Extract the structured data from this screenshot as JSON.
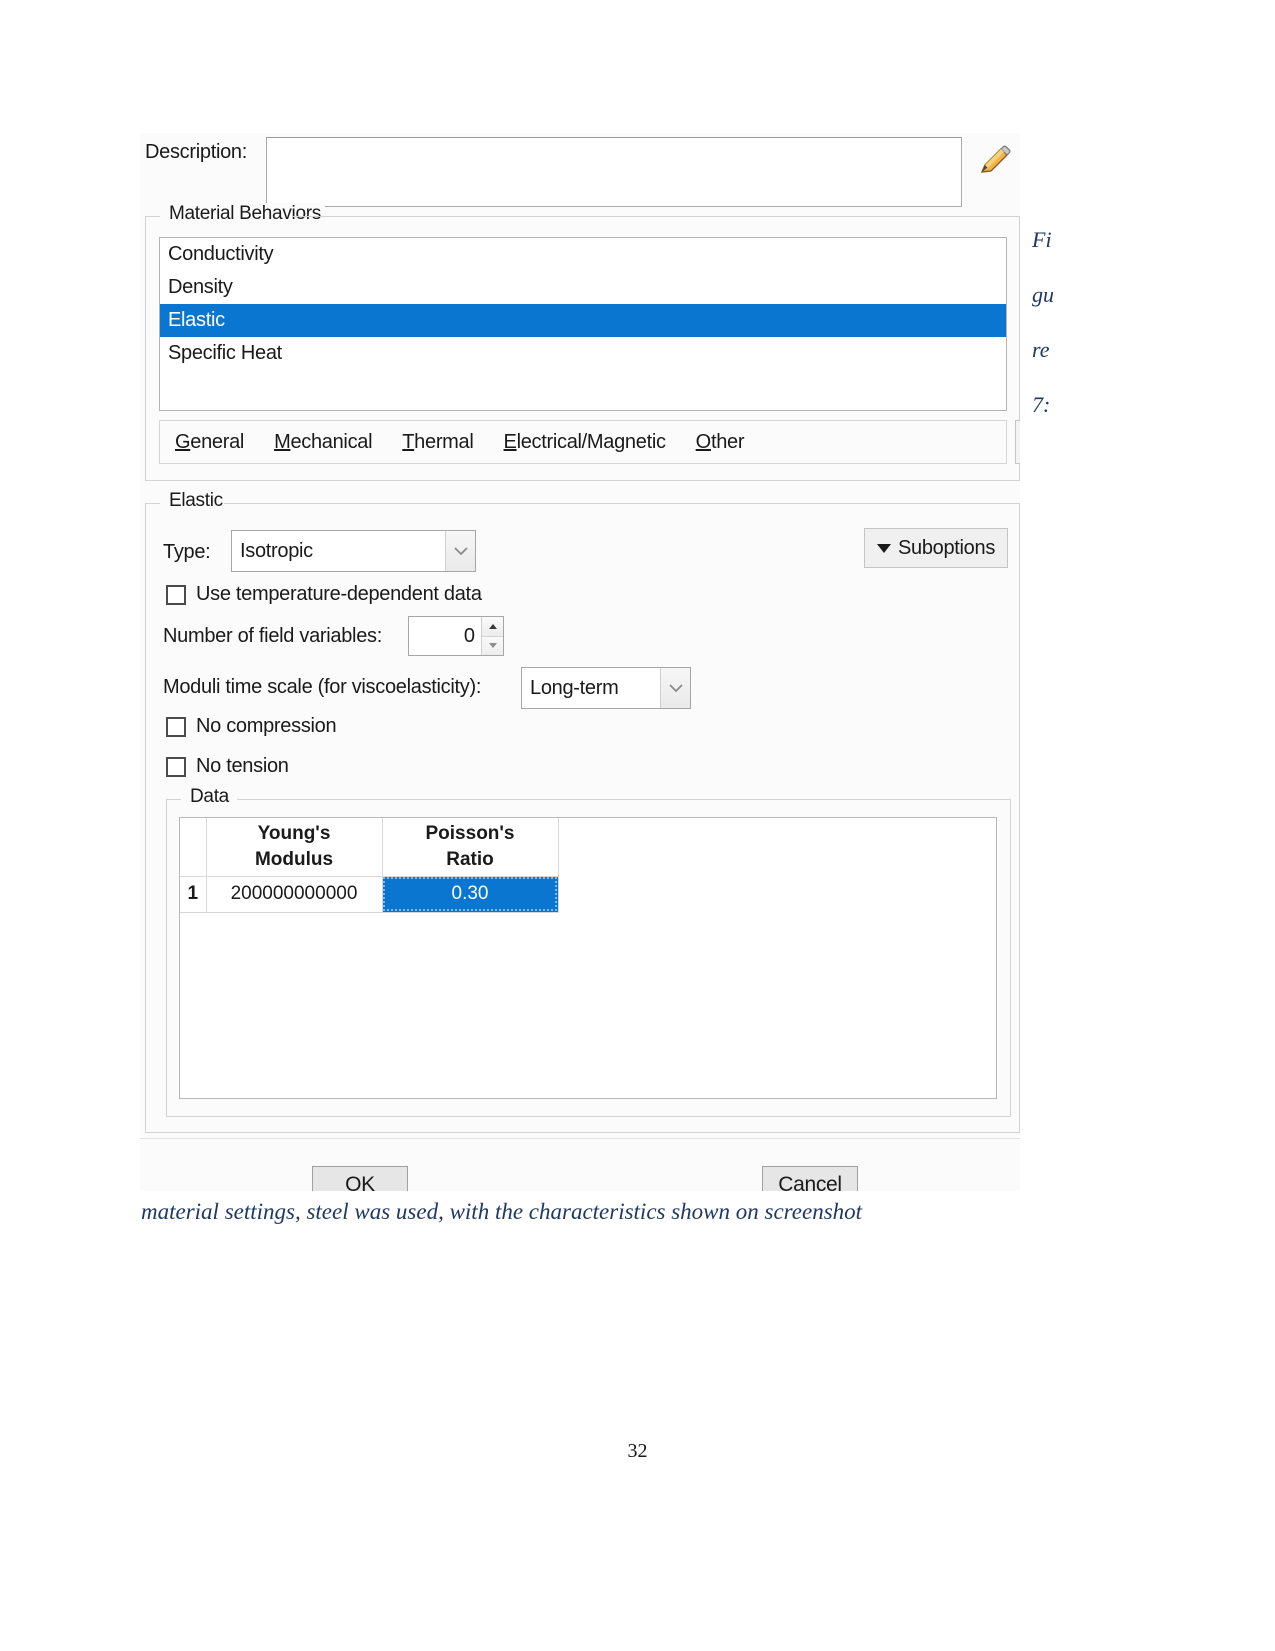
{
  "dialog": {
    "description": {
      "label": "Description:",
      "value": "",
      "placeholder": "",
      "edit_icon": "pencil-icon"
    },
    "material_behaviors": {
      "legend": "Material Behaviors",
      "items": [
        {
          "label": "Conductivity",
          "selected": false
        },
        {
          "label": "Density",
          "selected": false
        },
        {
          "label": "Elastic",
          "selected": true
        },
        {
          "label": "Specific Heat",
          "selected": false
        }
      ],
      "menubar": [
        {
          "accel": "G",
          "rest": "eneral"
        },
        {
          "accel": "M",
          "rest": "echanical"
        },
        {
          "accel": "T",
          "rest": "hermal"
        },
        {
          "accel": "E",
          "rest": "lectrical/Magnetic"
        },
        {
          "accel": "O",
          "rest": "ther"
        }
      ],
      "eraser_icon": "eraser-icon"
    },
    "elastic": {
      "legend": "Elastic",
      "type_label": "Type:",
      "type_value": "Isotropic",
      "suboptions_label": "Suboptions",
      "use_temp_dependent_label": "Use temperature-dependent data",
      "use_temp_dependent_checked": false,
      "num_field_vars_label": "Number of field variables:",
      "num_field_vars_value": "0",
      "moduli_label": "Moduli time scale (for viscoelasticity):",
      "moduli_value": "Long-term",
      "no_compression_label": "No compression",
      "no_compression_checked": false,
      "no_tension_label": "No tension",
      "no_tension_checked": false,
      "data": {
        "legend": "Data",
        "columns": [
          "Young's\nModulus",
          "Poisson's\nRatio"
        ],
        "col1_line1": "Young's",
        "col1_line2": "Modulus",
        "col2_line1": "Poisson's",
        "col2_line2": "Ratio",
        "rows": [
          {
            "index": "1",
            "youngs_modulus": "200000000000",
            "poissons_ratio": "0.30"
          }
        ],
        "selected_cell": "poissons_ratio"
      }
    },
    "footer": {
      "ok_label": "OK",
      "cancel_label": "Cancel"
    },
    "colors": {
      "selection_blue": "#0b76d0",
      "dialog_background": "#fbfbfb",
      "caption_blue": "#1f3864"
    }
  },
  "document": {
    "side_figure_lines": [
      "Fi",
      "gu",
      "re",
      "7:"
    ],
    "caption": "material settings, steel was used, with the characteristics shown on screenshot",
    "page_number": "32"
  }
}
